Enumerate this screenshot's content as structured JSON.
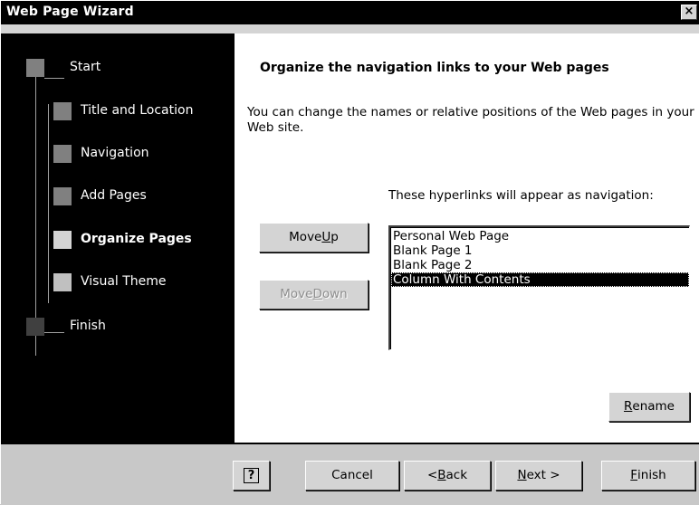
{
  "window": {
    "title": "Web Page Wizard",
    "close_label": "×"
  },
  "steps": [
    {
      "label": "Start",
      "state": "done"
    },
    {
      "label": "Title and Location",
      "state": "done"
    },
    {
      "label": "Navigation",
      "state": "done"
    },
    {
      "label": "Add Pages",
      "state": "done"
    },
    {
      "label": "Organize Pages",
      "state": "current"
    },
    {
      "label": "Visual Theme",
      "state": "pending"
    },
    {
      "label": "Finish",
      "state": "endpoint"
    }
  ],
  "main": {
    "heading": "Organize the navigation links to your Web pages",
    "description": "You can change the names or relative positions of the Web pages in your Web site.",
    "list_caption": "These hyperlinks will appear as navigation:",
    "move_up_label": {
      "pre": "Move ",
      "mnemonic": "U",
      "post": "p"
    },
    "move_down_label": {
      "pre": "Move ",
      "mnemonic": "D",
      "post": "own"
    },
    "rename_label": {
      "pre": "",
      "mnemonic": "R",
      "post": "ename"
    },
    "pages": [
      "Personal Web Page",
      "Blank Page 1",
      "Blank Page 2",
      "Column With Contents"
    ],
    "selected_page": "Column With Contents"
  },
  "footer": {
    "help_label": "?",
    "cancel_label": "Cancel",
    "back_label": {
      "pre": "< ",
      "mnemonic": "B",
      "post": "ack"
    },
    "next_label": {
      "pre": "",
      "mnemonic": "N",
      "post": "ext >"
    },
    "finish_label": {
      "pre": "",
      "mnemonic": "F",
      "post": "inish"
    }
  },
  "colors": {
    "step_done": "#808080",
    "step_current": "#d4d4d4",
    "step_pending": "#c0c0c0",
    "step_endpoint": "#404040"
  }
}
